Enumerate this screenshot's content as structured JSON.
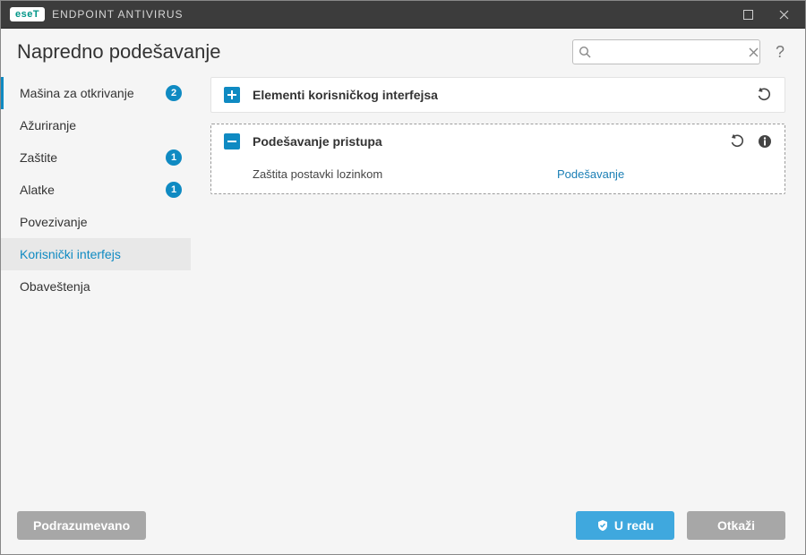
{
  "titlebar": {
    "brand_badge": "eseT",
    "product_name": "ENDPOINT ANTIVIRUS"
  },
  "header": {
    "title": "Napredno podešavanje",
    "search_placeholder": "",
    "help_label": "?"
  },
  "sidebar": {
    "items": [
      {
        "label": "Mašina za otkrivanje",
        "badge": "2",
        "active_parent": true
      },
      {
        "label": "Ažuriranje"
      },
      {
        "label": "Zaštite",
        "badge": "1"
      },
      {
        "label": "Alatke",
        "badge": "1"
      },
      {
        "label": "Povezivanje"
      },
      {
        "label": "Korisnički interfejs",
        "selected": true
      },
      {
        "label": "Obaveštenja"
      }
    ]
  },
  "sections": [
    {
      "expanded": false,
      "title": "Elementi korisničkog interfejsa",
      "show_undo": true,
      "show_info": false
    },
    {
      "expanded": true,
      "dashed": true,
      "title": "Podešavanje pristupa",
      "show_undo": true,
      "show_info": true,
      "rows": [
        {
          "label": "Zaštita postavki lozinkom",
          "link": "Podešavanje"
        }
      ]
    }
  ],
  "footer": {
    "default": "Podrazumevano",
    "ok": "U redu",
    "cancel": "Otkaži"
  },
  "colors": {
    "accent": "#0f8ac2",
    "primary_btn": "#3fa8de",
    "grey_btn": "#a7a7a7"
  }
}
